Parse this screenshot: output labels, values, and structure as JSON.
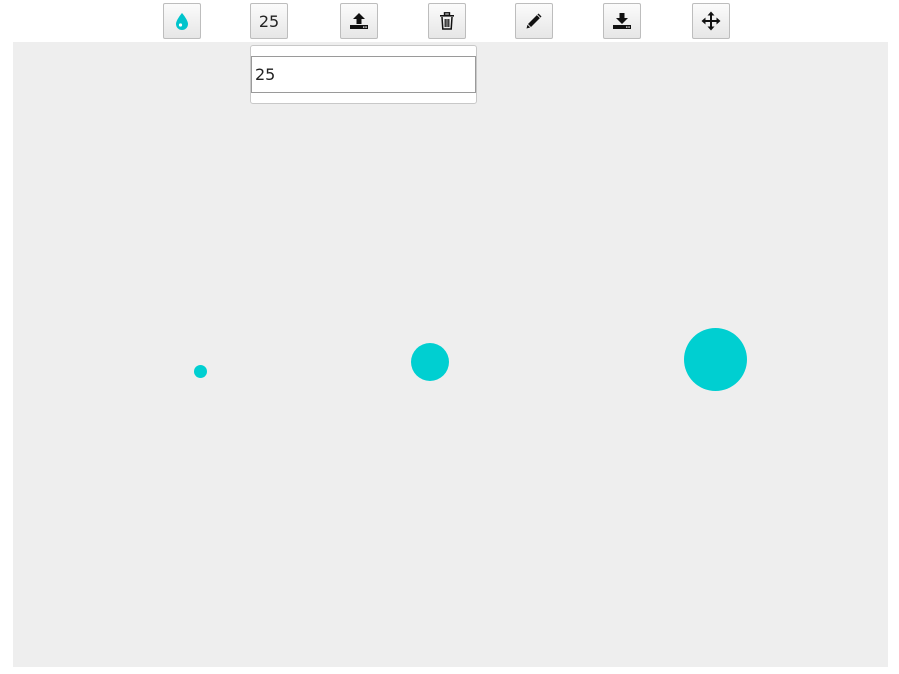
{
  "toolbar": {
    "buttons": [
      {
        "id": "color",
        "icon": "droplet-icon"
      },
      {
        "id": "size",
        "label": "25"
      },
      {
        "id": "upload",
        "icon": "upload-icon"
      },
      {
        "id": "delete",
        "icon": "trash-icon"
      },
      {
        "id": "edit",
        "icon": "pencil-icon"
      },
      {
        "id": "download",
        "icon": "download-icon"
      },
      {
        "id": "move",
        "icon": "move-arrows-icon"
      }
    ]
  },
  "size_popup": {
    "value": "25"
  },
  "canvas": {
    "background": "#eeeeee",
    "circle_color": "#00cfd1"
  },
  "colors": {
    "accent": "#00cfd1"
  }
}
